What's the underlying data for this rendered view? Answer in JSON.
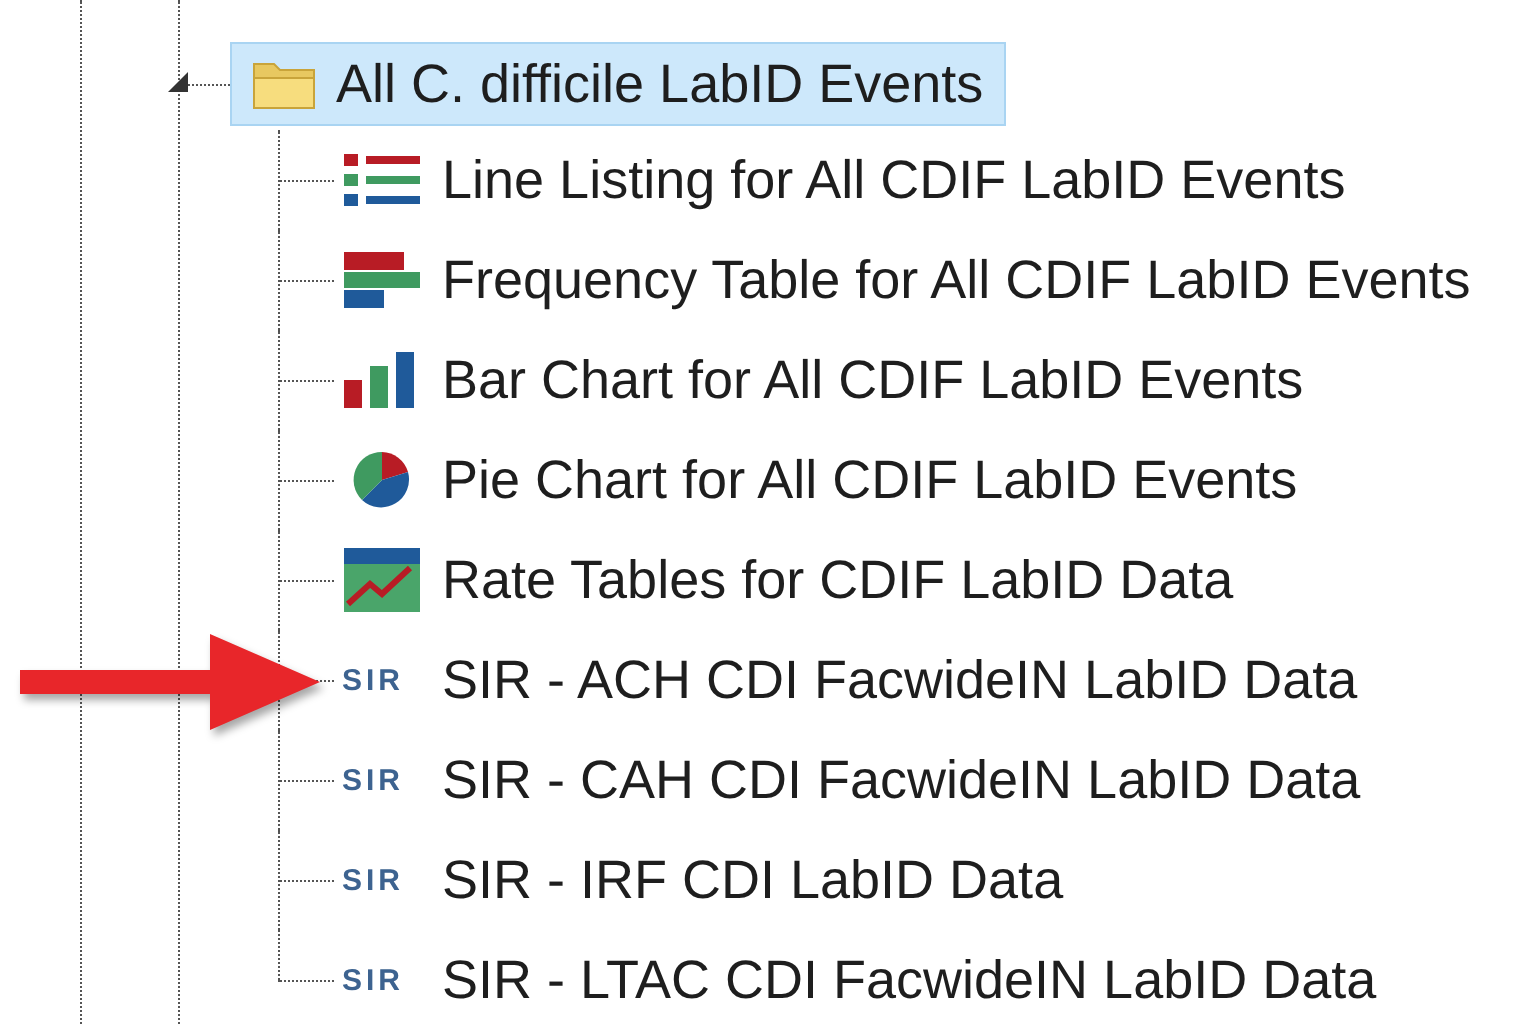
{
  "tree": {
    "folder": {
      "label": "All C. difficile LabID Events",
      "expanded": true,
      "selected": true,
      "children": [
        {
          "kind": "list",
          "label": "Line Listing for All CDIF LabID Events",
          "marked": false
        },
        {
          "kind": "frequency",
          "label": "Frequency Table for All CDIF LabID Events",
          "marked": false
        },
        {
          "kind": "bar",
          "label": "Bar Chart for All CDIF LabID Events",
          "marked": false
        },
        {
          "kind": "pie",
          "label": "Pie Chart for All CDIF LabID Events",
          "marked": false
        },
        {
          "kind": "rate",
          "label": "Rate Tables for CDIF LabID Data",
          "marked": false
        },
        {
          "kind": "sir",
          "icon_text": "SIR",
          "label": "SIR - ACH CDI FacwideIN LabID Data",
          "marked": true
        },
        {
          "kind": "sir",
          "icon_text": "SIR",
          "label": "SIR - CAH CDI FacwideIN LabID Data",
          "marked": false
        },
        {
          "kind": "sir",
          "icon_text": "SIR",
          "label": "SIR - IRF CDI LabID Data",
          "marked": false
        },
        {
          "kind": "sir",
          "icon_text": "SIR",
          "label": "SIR - LTAC CDI FacwideIN LabID Data",
          "marked": false
        }
      ]
    }
  }
}
